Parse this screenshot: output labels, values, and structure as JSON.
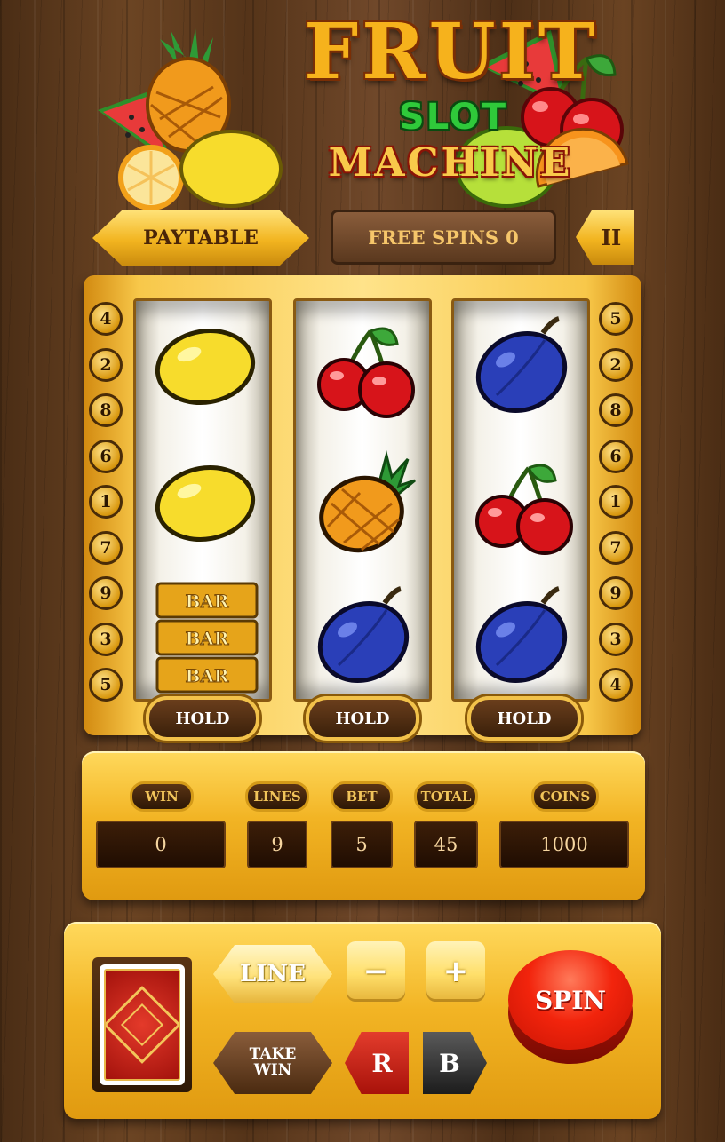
{
  "title": {
    "line1": "FRUIT",
    "line2": "SLOT",
    "line3": "MACHINE"
  },
  "top_bar": {
    "paytable_label": "PAYTABLE",
    "free_spins_label": "FREE SPINS",
    "free_spins_value": "0",
    "pause_label": "II"
  },
  "reels": [
    {
      "symbols": [
        "lemon",
        "lemon",
        "triple-bar"
      ]
    },
    {
      "symbols": [
        "cherry",
        "pineapple",
        "plum"
      ]
    },
    {
      "symbols": [
        "plum",
        "cherry",
        "plum"
      ]
    }
  ],
  "bar_label": "BAR",
  "paylines_left": [
    "4",
    "2",
    "8",
    "6",
    "1",
    "7",
    "9",
    "3",
    "5"
  ],
  "paylines_right": [
    "5",
    "2",
    "8",
    "6",
    "1",
    "7",
    "9",
    "3",
    "4"
  ],
  "hold_label": "HOLD",
  "stats": {
    "win_label": "WIN",
    "win_value": "0",
    "lines_label": "LINES",
    "lines_value": "9",
    "bet_label": "BET",
    "bet_value": "5",
    "total_label": "TOTAL",
    "total_value": "45",
    "coins_label": "COINS",
    "coins_value": "1000"
  },
  "controls": {
    "line_label": "LINE",
    "minus_label": "−",
    "plus_label": "+",
    "take_win_line1": "TAKE",
    "take_win_line2": "WIN",
    "red_label": "R",
    "black_label": "B",
    "spin_label": "SPIN"
  },
  "colors": {
    "gold": "#f2b424",
    "wood": "#5a381e",
    "spin_red": "#f2240c"
  }
}
